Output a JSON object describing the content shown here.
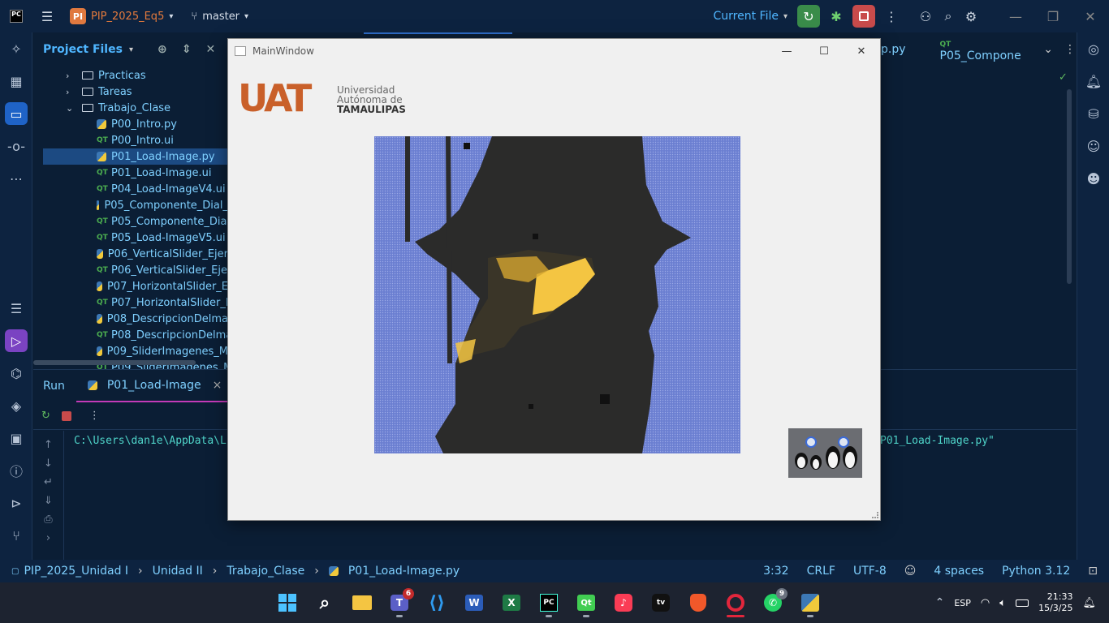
{
  "titlebar": {
    "project_badge": "PI",
    "project_name": "PIP_2025_Eq5",
    "branch": "master",
    "run_config": "Current File"
  },
  "project_panel": {
    "title": "Project Files",
    "tree": [
      {
        "label": "Practicas",
        "type": "folder",
        "expanded": false,
        "indent": 0
      },
      {
        "label": "Tareas",
        "type": "folder",
        "expanded": false,
        "indent": 0
      },
      {
        "label": "Trabajo_Clase",
        "type": "folder",
        "expanded": true,
        "indent": 0
      },
      {
        "label": "P00_Intro.py",
        "type": "py",
        "indent": 1
      },
      {
        "label": "P00_Intro.ui",
        "type": "ui",
        "indent": 1
      },
      {
        "label": "P01_Load-Image.py",
        "type": "py",
        "indent": 1,
        "selected": true
      },
      {
        "label": "P01_Load-Image.ui",
        "type": "ui",
        "indent": 1
      },
      {
        "label": "P04_Load-ImageV4.ui",
        "type": "ui",
        "indent": 1
      },
      {
        "label": "P05_Componente_Dial_",
        "type": "py",
        "indent": 1
      },
      {
        "label": "P05_Componente_Dial_",
        "type": "ui",
        "indent": 1
      },
      {
        "label": "P05_Load-ImageV5.ui",
        "type": "ui",
        "indent": 1
      },
      {
        "label": "P06_VerticalSlider_Ejer",
        "type": "py",
        "indent": 1
      },
      {
        "label": "P06_VerticalSlider_Ejer",
        "type": "ui",
        "indent": 1
      },
      {
        "label": "P07_HorizontalSlider_E",
        "type": "py",
        "indent": 1
      },
      {
        "label": "P07_HorizontalSlider_E",
        "type": "ui",
        "indent": 1
      },
      {
        "label": "P08_DescripcionDelma",
        "type": "py",
        "indent": 1
      },
      {
        "label": "P08_DescripcionDelma",
        "type": "ui",
        "indent": 1
      },
      {
        "label": "P09_SliderImagenes_M",
        "type": "py",
        "indent": 1
      },
      {
        "label": "P09_SliderImagenes_M",
        "type": "ui",
        "indent": 1
      }
    ]
  },
  "editor_tabs": {
    "partial_tab": "p.py",
    "tab2": "P05_Compone"
  },
  "run_panel": {
    "tab_run": "Run",
    "tab_config": "P01_Load-Image",
    "console_left": "C:\\Users\\dan1e\\AppData\\L",
    "console_right": "P01_Load-Image.py\""
  },
  "statusbar": {
    "breadcrumb": [
      "PIP_2025_Unidad I",
      "Unidad II",
      "Trabajo_Clase",
      "P01_Load-Image.py"
    ],
    "position": "3:32",
    "line_sep": "CRLF",
    "encoding": "UTF-8",
    "indent": "4 spaces",
    "interpreter": "Python 3.12"
  },
  "main_window": {
    "title": "MainWindow",
    "logo_big": "UAT",
    "logo_line1": "Universidad",
    "logo_line2": "Autónoma de",
    "logo_line3": "TAMAULIPAS"
  },
  "taskbar": {
    "teams_badge": "6",
    "whatsapp_badge": "9",
    "lang": "ESP",
    "time": "21:33",
    "date": "15/3/25"
  },
  "colors": {
    "ide_bg": "#0b1e35",
    "accent": "#4fb6ff",
    "uat_orange": "#c9602a",
    "image_blue": "#6b7fd1"
  }
}
